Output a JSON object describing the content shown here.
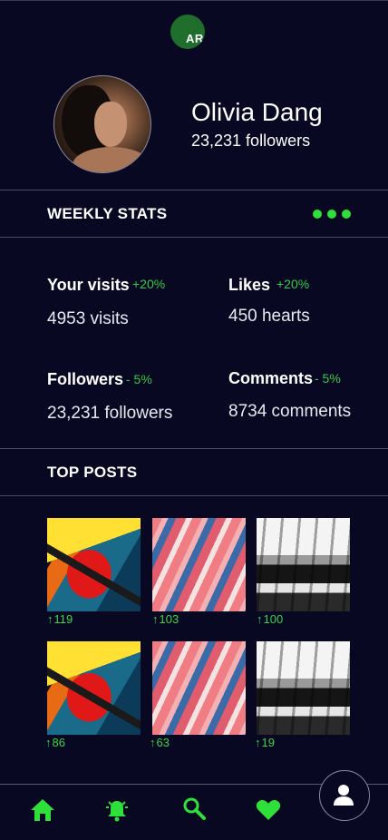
{
  "header": {
    "logo_text": "AR"
  },
  "profile": {
    "name": "Olivia Dang",
    "followers": "23,231 followers"
  },
  "weekly_stats": {
    "title": "WEEKLY STATS",
    "items": [
      {
        "label": "Your visits",
        "change": "+20%",
        "value": "4953 visits"
      },
      {
        "label": "Likes",
        "change": "+20%",
        "value": "450 hearts"
      },
      {
        "label": "Followers",
        "change": "- 5%",
        "value": "23,231 followers"
      },
      {
        "label": "Comments",
        "change": "- 5%",
        "value": "8734 comments"
      }
    ]
  },
  "top_posts": {
    "title": "TOP POSTS",
    "posts": [
      {
        "count": "119",
        "art": "abstract-red-yellow-blue"
      },
      {
        "count": "103",
        "art": "abstract-pink-blue-swirl"
      },
      {
        "count": "100",
        "art": "abstract-black-white-brush"
      },
      {
        "count": "86",
        "art": "abstract-red-yellow-blue"
      },
      {
        "count": "63",
        "art": "abstract-pink-blue-swirl"
      },
      {
        "count": "19",
        "art": "abstract-black-white-brush"
      }
    ]
  },
  "bottom_nav": {
    "items": [
      {
        "icon": "home-icon"
      },
      {
        "icon": "bell-icon"
      },
      {
        "icon": "search-icon"
      },
      {
        "icon": "heart-icon"
      },
      {
        "icon": "user-icon"
      }
    ]
  },
  "colors": {
    "background": "#080822",
    "accent": "#2fe03a",
    "change": "#37c94a",
    "logo": "#1f6e2c"
  }
}
